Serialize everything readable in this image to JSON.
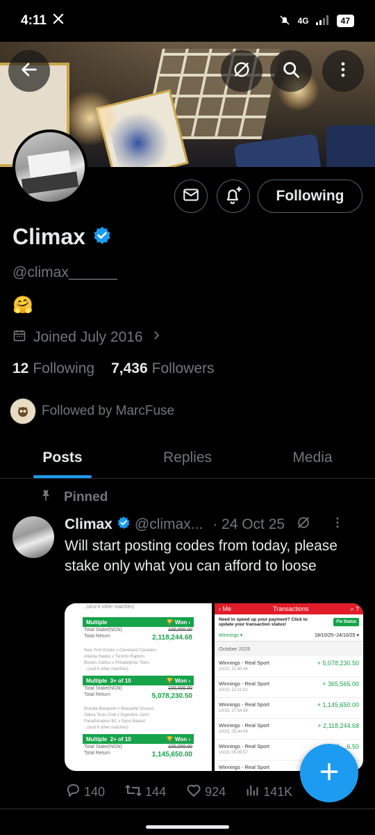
{
  "status_bar": {
    "time": "4:11",
    "network": "4G",
    "battery": "47"
  },
  "profile": {
    "name": "Climax",
    "handle": "@climax______",
    "bio": "🤗",
    "joined": "Joined July 2016",
    "following_count": "12",
    "following_label": "Following",
    "followers_count": "7,436",
    "followers_label": "Followers",
    "followed_by": "Followed by MarcFuse",
    "follow_button": "Following"
  },
  "tabs": [
    {
      "label": "Posts",
      "active": true
    },
    {
      "label": "Replies",
      "active": false
    },
    {
      "label": "Media",
      "active": false
    }
  ],
  "post": {
    "pinned_label": "Pinned",
    "author": "Climax",
    "handle": "@climax...",
    "date": "· 24 Oct 25",
    "text": "Will start posting codes from today, please stake only what you can afford to loose",
    "replies": "140",
    "reposts": "144",
    "likes": "924",
    "views": "141K"
  },
  "media": {
    "slip": {
      "top": "...(and 6 other matches)",
      "blocks": [
        {
          "label": "Multiple",
          "status": "Won",
          "stake_label": "Total Stake(NGN)",
          "stake": "100,000.00",
          "return_label": "Total Return",
          "return": "2,118,244.68",
          "matches": [
            "New York Knicks v Cleveland Cavaliers",
            "Atlanta Hawks v Toronto Raptors",
            "Boston Celtics v Philadelphia 76ers",
            "...(and 6 other matches)"
          ]
        },
        {
          "label": "Multiple",
          "extra": "3+ of 10",
          "status": "Won",
          "stake_label": "Total Stake(NGN)",
          "stake": "100,000.00",
          "return_label": "Total Return",
          "return": "5,078,230.50",
          "matches": [
            "Brasilia Basquete v Basquete Osasco",
            "Obera Tenis Club v Argentino Junin",
            "Panathinaikos BC v Nyon Basket",
            "...(and 6 other matches)"
          ]
        },
        {
          "label": "Multiple",
          "extra": "2+ of 10",
          "status": "Won",
          "stake_label": "Total Stake(NGN)",
          "stake": "100,000.00",
          "return_label": "Total Return",
          "return": "1,145,650.00",
          "matches": []
        }
      ]
    },
    "transactions": {
      "back": "Me",
      "title": "Transactions",
      "notice": "Need to speed up your payment? Click to update your transaction status!",
      "fix_button": "Fix Status",
      "filter": "Winnings",
      "range": "18/10/25~24/10/25",
      "month": "October 2025",
      "rows": [
        {
          "label": "Winnings - Real Sport",
          "date": "10/23, 21:45:44",
          "amount": "+ 5,078,230.50"
        },
        {
          "label": "Winnings - Real Sport",
          "date": "10/23, 21:21:01",
          "amount": "+ 365,565.00"
        },
        {
          "label": "Winnings - Real Sport",
          "date": "10/23, 17:54:58",
          "amount": "+ 1,145,650.00"
        },
        {
          "label": "Winnings - Real Sport",
          "date": "10/23, 05:44:09",
          "amount": "+ 2,118,244.68"
        },
        {
          "label": "Winnings - Real Sport",
          "date": "10/23, 05:09:57",
          "amount": "+ 1,...6.50"
        },
        {
          "label": "Winnings - Real Sport",
          "date": "",
          "amount": ""
        }
      ]
    }
  },
  "colors": {
    "accent": "#1d9bf0",
    "verified": "#1d9bf0",
    "muted": "#71767b",
    "border": "#2f3336",
    "won_green": "#16a34a",
    "header_red": "#e11d2a"
  }
}
